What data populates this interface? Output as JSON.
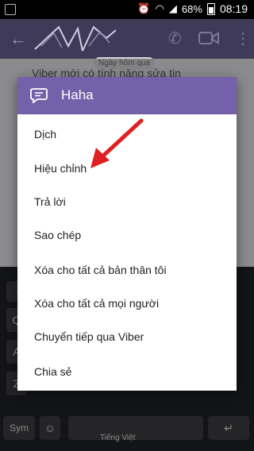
{
  "statusbar": {
    "battery": "68%",
    "time": "08:19"
  },
  "chat": {
    "date_label": "Ngày hôm qua",
    "message_text": "Viber mới có tính năng sửa tin"
  },
  "keyboard": {
    "language_label": "Tiếng Việt",
    "sym_label": "Sym",
    "keys_row": [
      "Q",
      "A",
      "Z"
    ]
  },
  "dialog": {
    "title": "Haha",
    "items": [
      {
        "label": "Dịch"
      },
      {
        "label": "Hiệu chỉnh"
      },
      {
        "label": "Trả lời"
      },
      {
        "label": "Sao chép"
      },
      {
        "label": "Xóa cho tất cả bản thân tôi"
      },
      {
        "label": "Xóa cho tất cả mọi người"
      },
      {
        "label": "Chuyển tiếp qua Viber"
      },
      {
        "label": "Chia sẻ"
      }
    ]
  },
  "colors": {
    "header_purple": "#7461a9",
    "appbar": "#3f3a58",
    "arrow_red": "#e02020"
  }
}
